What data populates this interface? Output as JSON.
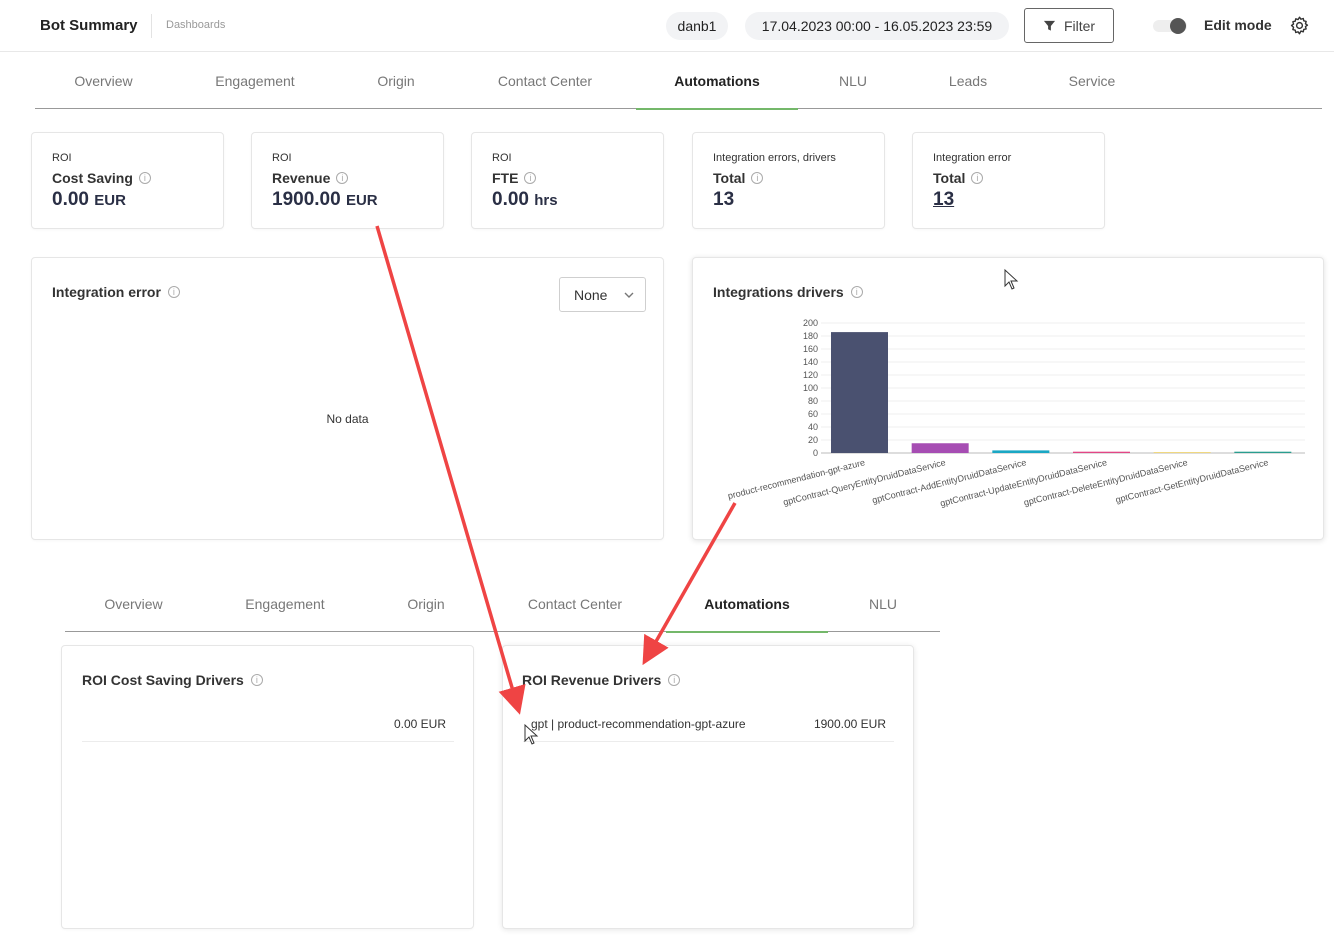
{
  "header": {
    "title": "Bot Summary",
    "breadcrumb": "Dashboards",
    "bot": "danb1",
    "date_range": "17.04.2023 00:00 - 16.05.2023 23:59",
    "filter_label": "Filter",
    "edit_mode_label": "Edit mode"
  },
  "tabs": [
    "Overview",
    "Engagement",
    "Origin",
    "Contact Center",
    "Automations",
    "NLU",
    "Leads",
    "Service"
  ],
  "tabs_bottom": [
    "Overview",
    "Engagement",
    "Origin",
    "Contact Center",
    "Automations",
    "NLU"
  ],
  "active_tab": "Automations",
  "kpis": [
    {
      "caption": "ROI",
      "label": "Cost Saving",
      "value": "0.00",
      "unit": "EUR"
    },
    {
      "caption": "ROI",
      "label": "Revenue",
      "value": "1900.00",
      "unit": "EUR"
    },
    {
      "caption": "ROI",
      "label": "FTE",
      "value": "0.00",
      "unit": "hrs"
    },
    {
      "caption": "Integration errors, drivers",
      "label": "Total",
      "value": "13",
      "unit": ""
    },
    {
      "caption": "Integration error",
      "label": "Total",
      "value": "13",
      "unit": ""
    }
  ],
  "integration_error": {
    "title": "Integration error",
    "select_value": "None",
    "empty_text": "No data"
  },
  "drivers_chart": {
    "title": "Integrations drivers"
  },
  "chart_data": {
    "type": "bar",
    "title": "Integrations drivers",
    "categories": [
      "product-recommendation-gpt-azure",
      "gptContract-QueryEntityDruidDataService",
      "gptContract-AddEntityDruidDataService",
      "gptContract-UpdateEntityDruidDataService",
      "gptContract-DeleteEntityDruidDataService",
      "gptContract-GetEntityDruidDataService"
    ],
    "values": [
      186,
      15,
      4,
      2,
      1,
      2
    ],
    "colors": [
      "#4a5170",
      "#a64db3",
      "#1aa7c4",
      "#e24686",
      "#e8c33c",
      "#2a9d8f"
    ],
    "yticks": [
      0,
      20,
      40,
      60,
      80,
      100,
      120,
      140,
      160,
      180,
      200
    ],
    "ylim": [
      0,
      200
    ],
    "grid": true,
    "xlabel": "",
    "ylabel": ""
  },
  "roi_cost_saving": {
    "title": "ROI Cost Saving Drivers",
    "rows": [
      {
        "name": "",
        "value": "0.00 EUR"
      }
    ]
  },
  "roi_revenue": {
    "title": "ROI Revenue Drivers",
    "rows": [
      {
        "name": "gpt | product-recommendation-gpt-azure",
        "value": "1900.00 EUR"
      }
    ]
  },
  "colors": {
    "accent": "#74b86a",
    "kpi_value": "#2a2f45",
    "arrow": "#ef4444"
  }
}
